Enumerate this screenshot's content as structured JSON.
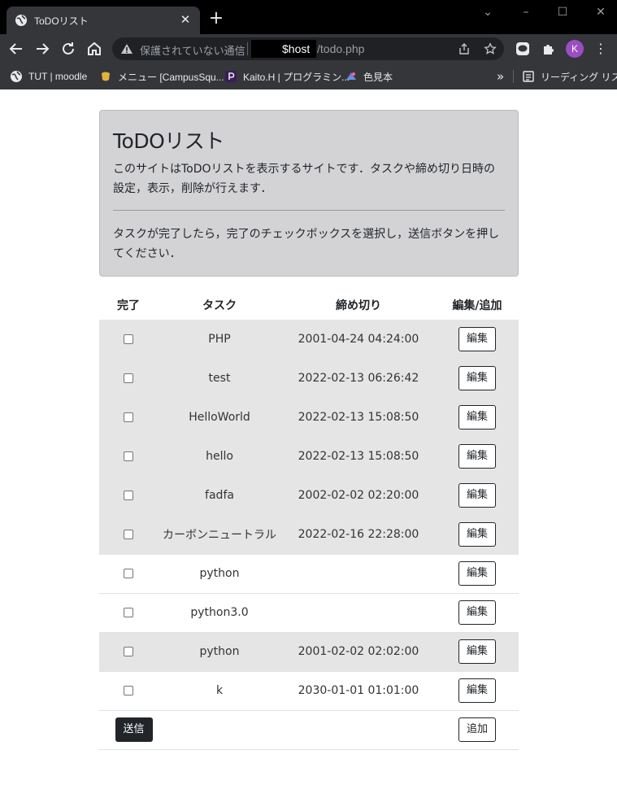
{
  "browser": {
    "tab_title": "ToDOリスト",
    "tab_close": "✕",
    "new_tab": "+",
    "address": {
      "security_label": "保護されていない通信",
      "host": "$host",
      "path": "/todo.php"
    },
    "avatar_initial": "K",
    "bookmarks": [
      {
        "label": "TUT | moodle",
        "icon": "globe-icon"
      },
      {
        "label": "メニュー [CampusSqu...",
        "icon": "campussquare-icon"
      },
      {
        "label": "Kaito.H | プログラミン...",
        "icon": "profile-icon"
      },
      {
        "label": "色見本",
        "icon": "color-sample-icon"
      }
    ],
    "overflow": "»",
    "reading_list": "リーディング リスト"
  },
  "header": {
    "title": "ToDOリスト",
    "lead": "このサイトはToDOリストを表示するサイトです．タスクや締め切り日時の設定，表示，削除が行えます．",
    "note": "タスクが完了したら，完了のチェックボックスを選択し，送信ボタンを押してください．"
  },
  "table": {
    "headers": {
      "done": "完了",
      "task": "タスク",
      "deadline": "締め切り",
      "edit": "編集/追加"
    },
    "rows": [
      {
        "task": "PHP",
        "deadline": "2001-04-24 04:24:00",
        "edit": "編集",
        "shaded": true
      },
      {
        "task": "test",
        "deadline": "2022-02-13 06:26:42",
        "edit": "編集",
        "shaded": true
      },
      {
        "task": "HelloWorld",
        "deadline": "2022-02-13 15:08:50",
        "edit": "編集",
        "shaded": true
      },
      {
        "task": "hello",
        "deadline": "2022-02-13 15:08:50",
        "edit": "編集",
        "shaded": true
      },
      {
        "task": "fadfa",
        "deadline": "2002-02-02 02:20:00",
        "edit": "編集",
        "shaded": true
      },
      {
        "task": "カーボンニュートラル",
        "deadline": "2022-02-16 22:28:00",
        "edit": "編集",
        "shaded": true
      },
      {
        "task": "python",
        "deadline": "",
        "edit": "編集",
        "shaded": false
      },
      {
        "task": "python3.0",
        "deadline": "",
        "edit": "編集",
        "shaded": false
      },
      {
        "task": "python",
        "deadline": "2001-02-02 02:02:00",
        "edit": "編集",
        "shaded": true
      },
      {
        "task": "k",
        "deadline": "2030-01-01 01:01:00",
        "edit": "編集",
        "shaded": false
      }
    ],
    "submit_label": "送信",
    "add_label": "追加"
  },
  "colors": {
    "shaded_row": "#e5e5e5",
    "jumbotron": "#d3d3d6",
    "dark_button": "#212529"
  }
}
